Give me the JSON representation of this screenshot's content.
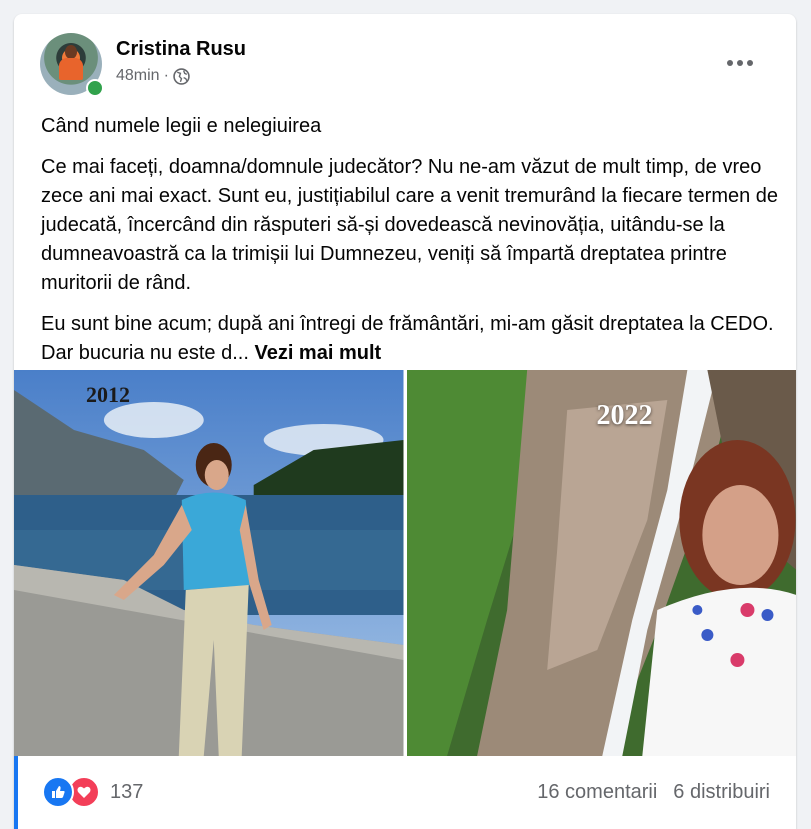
{
  "post": {
    "author": "Cristina Rusu",
    "time": "48min",
    "separator": "·",
    "privacy_icon": "globe-icon",
    "title": "Când numele legii e nelegiuirea",
    "paragraph1": "Ce mai faceți, doamna/domnule judecător? Nu ne-am văzut de mult timp, de vreo zece ani mai exact. Sunt eu, justițiabilul care a venit tremurând la fiecare termen de judecată, încercând din răsputeri să-și dovedească nevinovăția, uitându-se la dumneavoastră ca la trimișii lui Dumnezeu, veniți să împartă dreptatea printre muritorii de rând.",
    "paragraph2": "Eu sunt bine acum; după ani întregi de frământări, mi-am găsit dreptatea la CEDO. Dar bucuria nu este d...",
    "see_more": "Vezi mai mult"
  },
  "photos": [
    {
      "label": "2012"
    },
    {
      "label": "2022"
    }
  ],
  "footer": {
    "reaction_icons": [
      "like-icon",
      "love-icon"
    ],
    "reaction_count": "137",
    "comments": "16 comentarii",
    "shares": "6 distribuiri"
  },
  "colors": {
    "accent": "#1877f2",
    "love": "#f33e58",
    "online": "#31a24c",
    "secondary_text": "#65676b"
  }
}
